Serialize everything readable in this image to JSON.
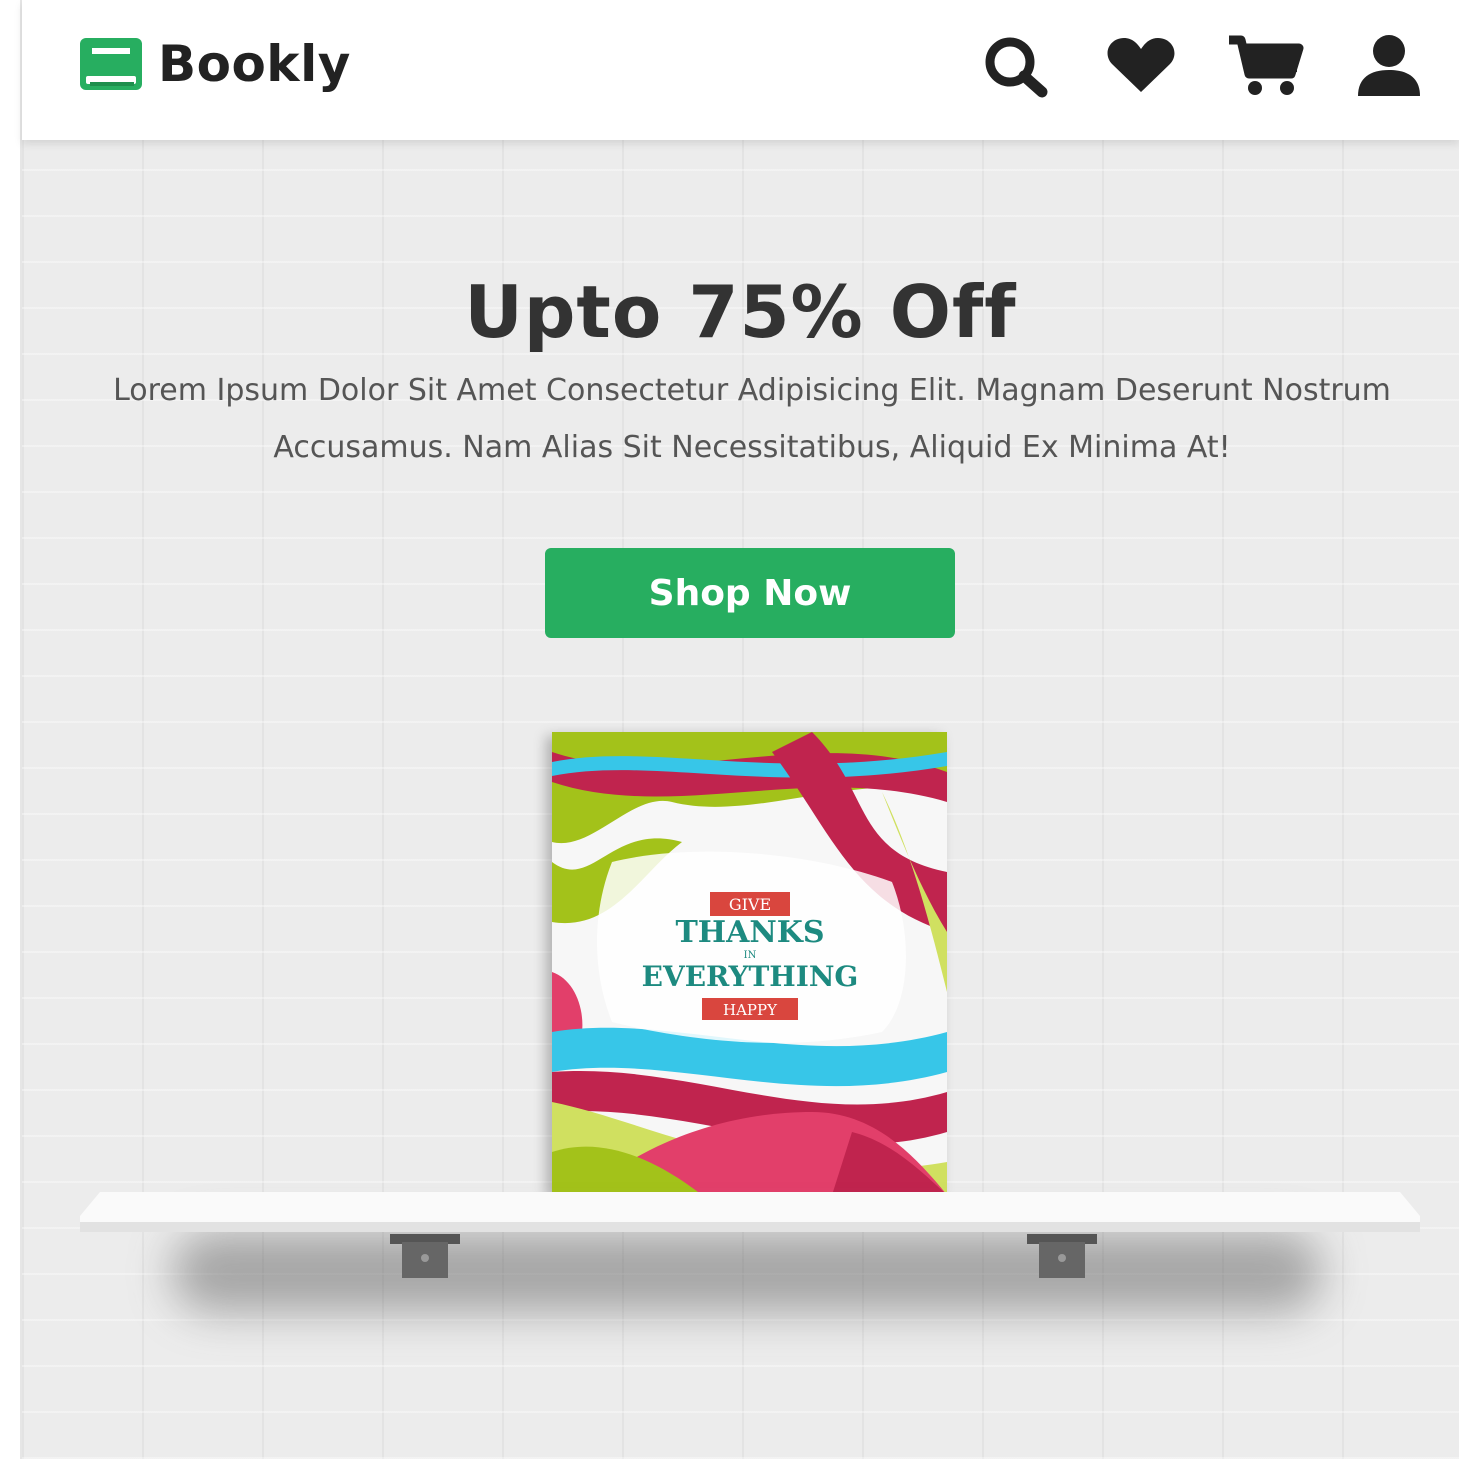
{
  "header": {
    "brand": "Bookly",
    "icons": [
      "search-icon",
      "heart-icon",
      "cart-icon",
      "user-icon"
    ]
  },
  "hero": {
    "title": "Upto 75% Off",
    "description": "Lorem Ipsum Dolor Sit Amet Consectetur Adipisicing Elit. Magnam Deserunt Nostrum Accusamus. Nam Alias Sit Necessitatibus, Aliquid Ex Minima At!",
    "button_label": "Shop Now"
  },
  "book_cover": {
    "line1": "GIVE",
    "line2": "THANKS",
    "line3": "IN",
    "line4": "EVERYTHING",
    "line5": "HAPPY"
  },
  "colors": {
    "accent": "#27ae60",
    "text_dark": "#333333",
    "text_muted": "#555555",
    "hero_bg": "#ececec"
  }
}
